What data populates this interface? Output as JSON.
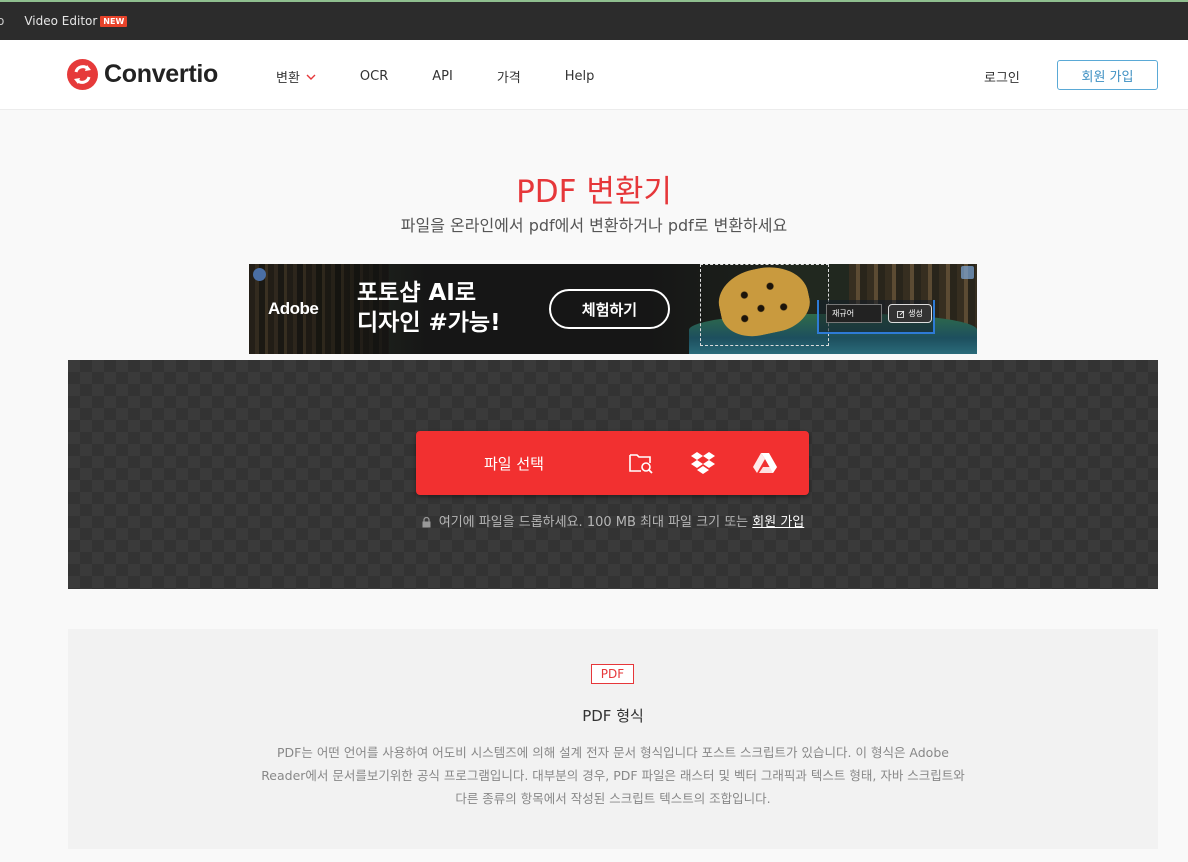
{
  "topbar": {
    "cut_text": "o",
    "video_editor": "Video Editor",
    "new_badge": "NEW"
  },
  "header": {
    "logo_text": "Convertio",
    "nav": [
      {
        "label": "변환",
        "has_dropdown": true
      },
      {
        "label": "OCR"
      },
      {
        "label": "API"
      },
      {
        "label": "가격"
      },
      {
        "label": "Help"
      }
    ],
    "login": "로그인",
    "signup": "회원 가입"
  },
  "hero": {
    "title": "PDF 변환기",
    "subtitle": "파일을 온라인에서 pdf에서 변환하거나 pdf로 변환하세요"
  },
  "ad": {
    "brand": "Adobe",
    "headline_line1": "포토샵 AI로",
    "headline_line2": "디자인 #가능!",
    "cta": "체험하기",
    "gen_input": "재규어",
    "gen_button": "생성"
  },
  "upload": {
    "choose_label": "파일 선택",
    "drop_hint": "여기에 파일을 드롭하세요. 100 MB 최대 파일 크기 또는",
    "drop_hint_link": "회원 가입",
    "icons": [
      "folder-search-icon",
      "dropbox-icon",
      "google-drive-icon"
    ]
  },
  "info": {
    "badge": "PDF",
    "title": "PDF 형식",
    "description": "PDF는 어떤 언어를 사용하여 어도비 시스템즈에 의해 설계 전자 문서 형식입니다 포스트 스크립트가 있습니다. 이 형식은 Adobe Reader에서 문서를보기위한 공식 프로그램입니다. 대부분의 경우, PDF 파일은 래스터 및 벡터 그래픽과 텍스트 형태, 자바 스크립트와 다른 종류의 항목에서 작성된 스크립트 텍스트의 조합입니다."
  },
  "colors": {
    "brand_red": "#e6373a",
    "button_red": "#f23030",
    "signup_blue": "#3c8fc2"
  }
}
